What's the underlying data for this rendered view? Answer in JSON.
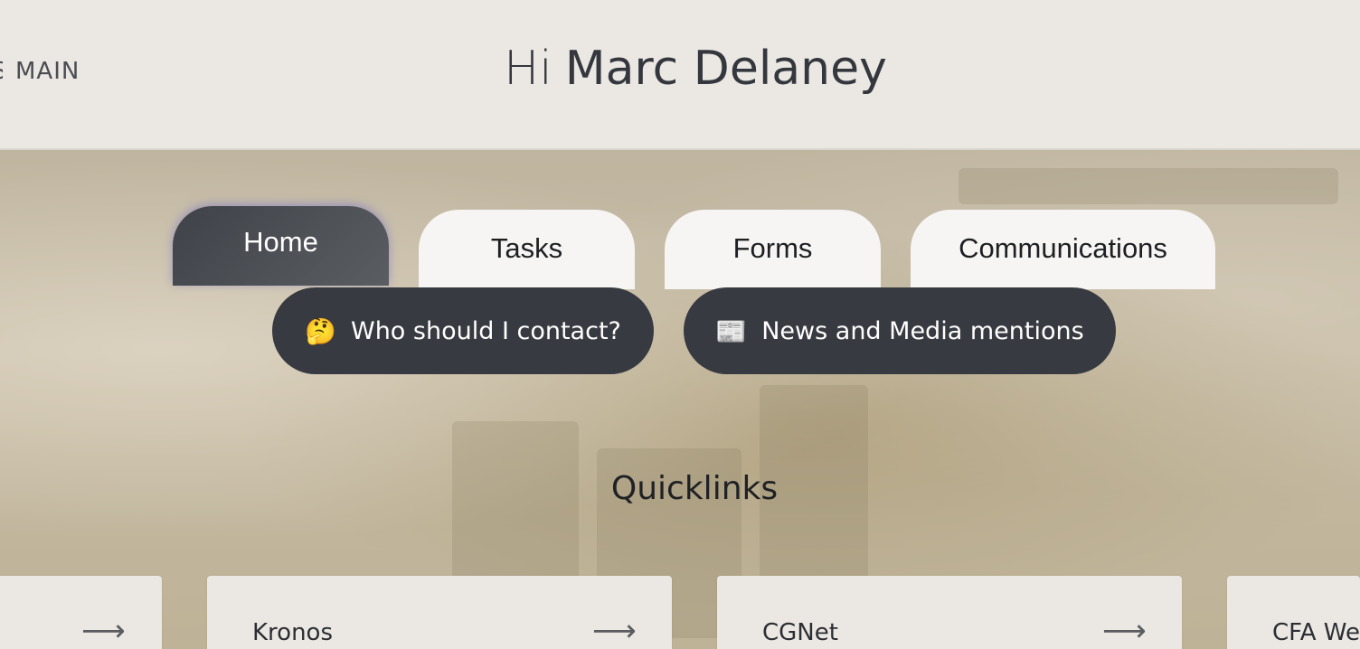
{
  "header": {
    "nav_partial": "S",
    "nav_main": "MAIN",
    "greeting_hi": "Hi",
    "greeting_name": "Marc Delaney"
  },
  "tabs": [
    {
      "label": "Home",
      "active": true
    },
    {
      "label": "Tasks",
      "active": false
    },
    {
      "label": "Forms",
      "active": false
    },
    {
      "label": "Communications",
      "active": false
    }
  ],
  "pills": [
    {
      "emoji": "🤔",
      "icon": "thinking-face-icon",
      "label": "Who should I contact?"
    },
    {
      "emoji": "📰",
      "icon": "newspaper-icon",
      "label": "News and Media mentions"
    }
  ],
  "quicklinks": {
    "title": "Quicklinks",
    "arrow": "⟶",
    "cards": [
      {
        "label": ""
      },
      {
        "label": "Kronos"
      },
      {
        "label": "CGNet"
      },
      {
        "label": "CFA We"
      }
    ]
  },
  "colors": {
    "header_bg": "#ebe8e3",
    "active_tab": "#45484e",
    "pill_bg": "#373a40",
    "tab_bg": "#f6f5f3"
  }
}
